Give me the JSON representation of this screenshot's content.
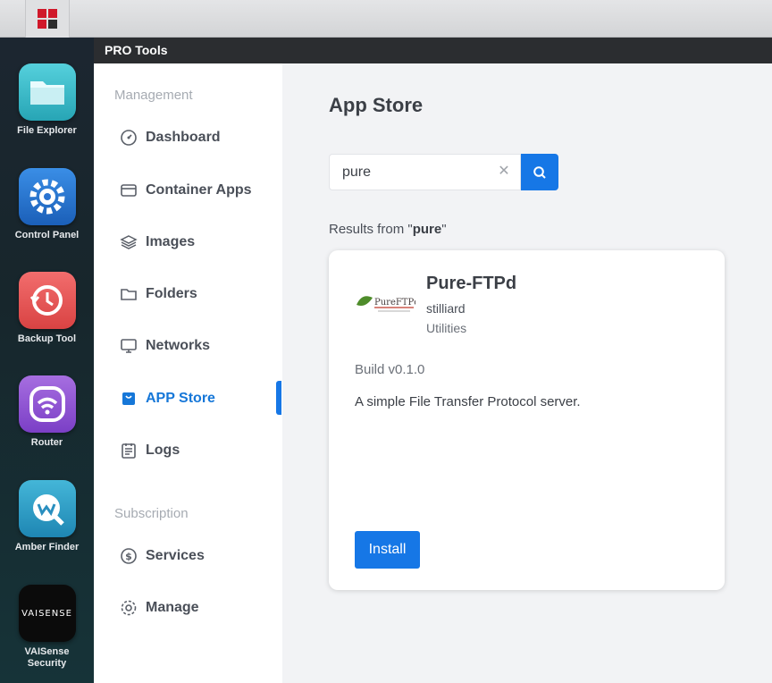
{
  "header": {
    "title": "PRO Tools"
  },
  "dock": {
    "items": [
      {
        "label": "File Explorer"
      },
      {
        "label": "Control Panel"
      },
      {
        "label": "Backup Tool"
      },
      {
        "label": "Router"
      },
      {
        "label": "Amber Finder"
      },
      {
        "label": "VAISense Security",
        "logo_text": "VAISENSE"
      }
    ]
  },
  "sidebar": {
    "management_label": "Management",
    "subscription_label": "Subscription",
    "items": [
      {
        "label": "Dashboard",
        "icon": "dashboard-icon"
      },
      {
        "label": "Container Apps",
        "icon": "container-icon"
      },
      {
        "label": "Images",
        "icon": "layers-icon"
      },
      {
        "label": "Folders",
        "icon": "folder-icon"
      },
      {
        "label": "Networks",
        "icon": "monitor-icon"
      },
      {
        "label": "APP Store",
        "icon": "store-icon",
        "active": true
      },
      {
        "label": "Logs",
        "icon": "logs-icon"
      },
      {
        "label": "Services",
        "icon": "dollar-icon"
      },
      {
        "label": "Manage",
        "icon": "gear-icon"
      }
    ]
  },
  "main": {
    "title": "App Store",
    "search": {
      "value": "pure"
    },
    "results_prefix": "Results from \"",
    "results_query": "pure",
    "results_suffix": "\"",
    "card": {
      "name": "Pure-FTPd",
      "logo_text": "PureFTPd",
      "author": "stilliard",
      "category": "Utilities",
      "build": "Build v0.1.0",
      "description": "A simple File Transfer Protocol server.",
      "install_label": "Install"
    }
  },
  "colors": {
    "accent": "#1677e6",
    "sidebar_active": "#1677d8",
    "header_bg": "#2b2d30"
  }
}
